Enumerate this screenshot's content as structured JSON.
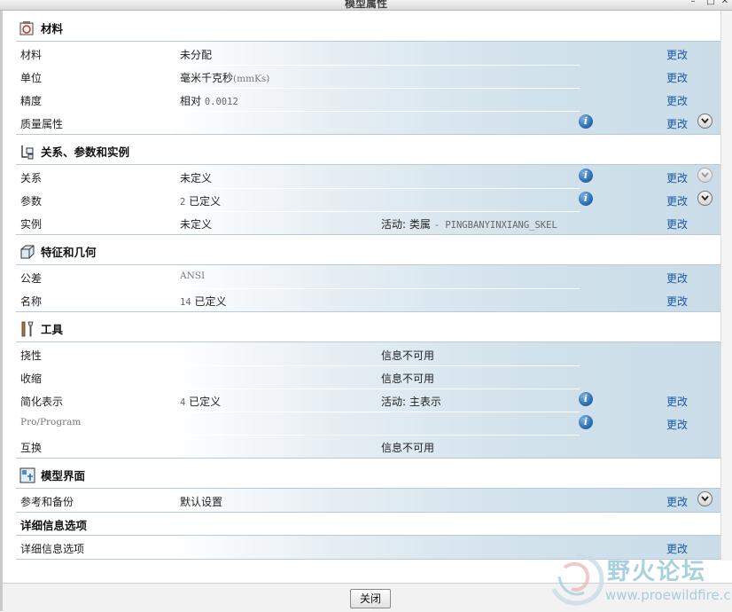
{
  "window": {
    "title": "模型属性"
  },
  "sections": {
    "material": {
      "title": "材料",
      "rows": [
        {
          "label": "材料",
          "value": "未分配",
          "change": "更改"
        },
        {
          "label": "单位",
          "value": "毫米千克秒",
          "value_extra": "(mmKs)",
          "change": "更改"
        },
        {
          "label": "精度",
          "value": "相对",
          "value_extra": "0.0012",
          "change": "更改"
        },
        {
          "label": "质量属性",
          "change": "更改"
        }
      ]
    },
    "relations": {
      "title": "关系、参数和实例",
      "rows": [
        {
          "label": "关系",
          "value": "未定义",
          "change": "更改"
        },
        {
          "label": "参数",
          "value_num": "2",
          "value": "已定义",
          "change": "更改"
        },
        {
          "label": "实例",
          "value": "未定义",
          "value3": "活动: 类属",
          "value3_extra": "- PINGBANYINXIANG_SKEL",
          "change": "更改"
        }
      ]
    },
    "features": {
      "title": "特征和几何",
      "rows": [
        {
          "label": "公差",
          "value": "ANSI",
          "change": "更改"
        },
        {
          "label": "名称",
          "value_num": "14",
          "value": "已定义",
          "change": "更改"
        }
      ]
    },
    "tools": {
      "title": "工具",
      "rows": [
        {
          "label": "挠性",
          "value3": "信息不可用"
        },
        {
          "label": "收缩",
          "value3": "信息不可用"
        },
        {
          "label": "简化表示",
          "value_num": "4",
          "value": "已定义",
          "value3": "活动: 主表示",
          "change": "更改"
        },
        {
          "label": "Pro/Program",
          "change": "更改"
        },
        {
          "label": "互换",
          "value3": "信息不可用"
        }
      ]
    },
    "interface": {
      "title": "模型界面",
      "rows": [
        {
          "label": "参考和备份",
          "value": "默认设置",
          "change": "更改"
        }
      ]
    },
    "detail": {
      "title": "详细信息选项",
      "rows": [
        {
          "label": "详细信息选项",
          "change": "更改"
        }
      ]
    }
  },
  "footer": {
    "close_label": "关闭"
  },
  "watermark": {
    "name": "野火论坛",
    "url": "www.proewildfire.cn"
  },
  "icons": [
    "material-icon",
    "relations-icon",
    "features-icon",
    "tools-icon",
    "interface-icon",
    "info-icon",
    "chevron-down-icon"
  ],
  "colors": {
    "link": "#1a58a8",
    "row_band": "#c9dce8",
    "info": "#2d6fb4"
  }
}
